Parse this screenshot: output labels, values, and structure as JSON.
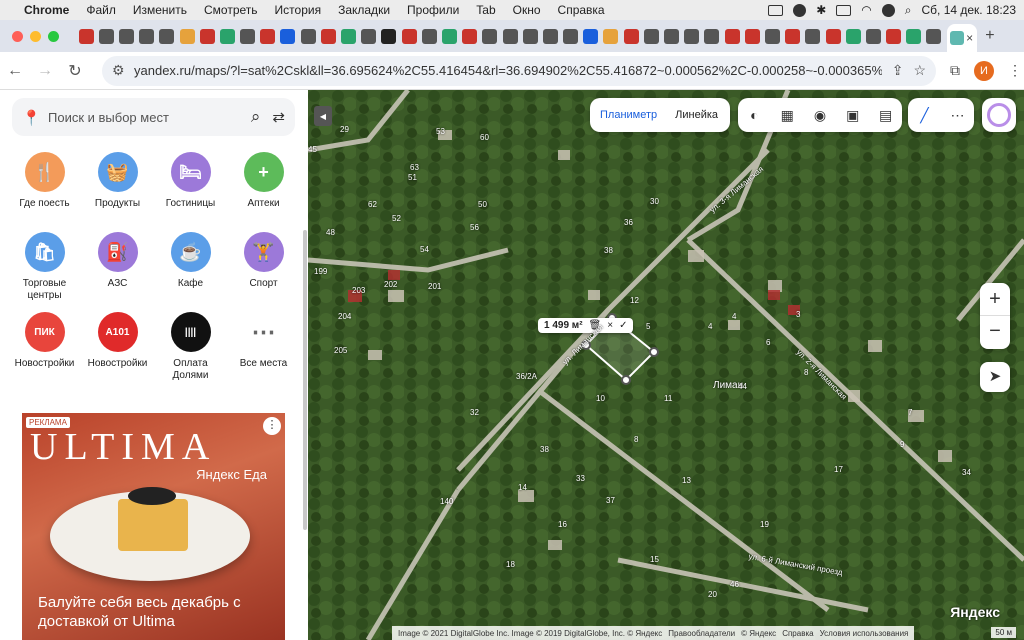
{
  "menubar": {
    "app": "Chrome",
    "items": [
      "Файл",
      "Изменить",
      "Смотреть",
      "История",
      "Закладки",
      "Профили",
      "Tab",
      "Окно",
      "Справка"
    ],
    "datetime": "Сб, 14 дек.  18:23"
  },
  "tabs": {
    "count": 46,
    "add": "+",
    "close": "×"
  },
  "toolbar": {
    "url": "yandex.ru/maps/?l=sat%2Cskl&ll=36.695624%2C55.416454&rl=36.694902%2C55.416872~0.000562%2C-0.000258~-0.000365%2...",
    "profile_initial": "И"
  },
  "sidebar": {
    "search_placeholder": "Поиск и выбор мест",
    "categories": [
      {
        "label": "Где поесть",
        "color": "#f39b5a",
        "icon": "🍴"
      },
      {
        "label": "Продукты",
        "color": "#5b9ee8",
        "icon": "🧺"
      },
      {
        "label": "Гостиницы",
        "color": "#9c79d9",
        "icon": "🛏"
      },
      {
        "label": "Аптеки",
        "color": "#5dbb5a",
        "icon": "+"
      },
      {
        "label": "Торговые центры",
        "color": "#5b9ee8",
        "icon": "🛍"
      },
      {
        "label": "АЗС",
        "color": "#9c79d9",
        "icon": "⛽"
      },
      {
        "label": "Кафе",
        "color": "#5b9ee8",
        "icon": "☕"
      },
      {
        "label": "Спорт",
        "color": "#9c79d9",
        "icon": "🏋"
      },
      {
        "label": "Новостройки",
        "color": "#e8453c",
        "icon": "ПИК"
      },
      {
        "label": "Новостройки",
        "color": "#e02a2a",
        "icon": "A101"
      },
      {
        "label": "Оплата Долями",
        "color": "#111111",
        "icon": "||||"
      },
      {
        "label": "Все места",
        "color": "#ffffff",
        "icon": "⋯"
      }
    ],
    "ad": {
      "tag": "РЕКЛАМА",
      "brand": "ULTIMA",
      "partner": "Яндекс Еда",
      "text": "Балуйте себя весь декабрь с доставкой от Ultima"
    }
  },
  "map": {
    "tools": {
      "planimeter": "Планиметр",
      "ruler": "Линейка"
    },
    "zoom_in": "+",
    "zoom_out": "−",
    "measure": "1 499 м²",
    "district": "Лиман",
    "streets": [
      "ул. 3-я Лиманская",
      "ул. Лиманская",
      "ул. 2-я Лиманская",
      "ул. 6-й Лиманский проезд"
    ],
    "houses": [
      "29",
      "53",
      "45",
      "60",
      "63",
      "51",
      "62",
      "50",
      "48",
      "52",
      "199",
      "56",
      "54",
      "30",
      "36",
      "38",
      "203",
      "202",
      "201",
      "204",
      "205",
      "36/2А",
      "5",
      "4",
      "4",
      "3",
      "6",
      "8",
      "7",
      "9",
      "10",
      "11",
      "8",
      "12",
      "32",
      "38",
      "33",
      "14",
      "17",
      "13",
      "37",
      "15",
      "16",
      "18",
      "19",
      "46",
      "34",
      "140",
      "20",
      "44"
    ],
    "footer": [
      "Image © 2021 DigitalGlobe Inc. Image © 2019 DigitalGlobe, Inc. © Яндекс",
      "Правообладатели",
      "© Яндекс",
      "Справка",
      "Условия использования"
    ],
    "logo": "Яндекс",
    "scale": "50 м"
  }
}
